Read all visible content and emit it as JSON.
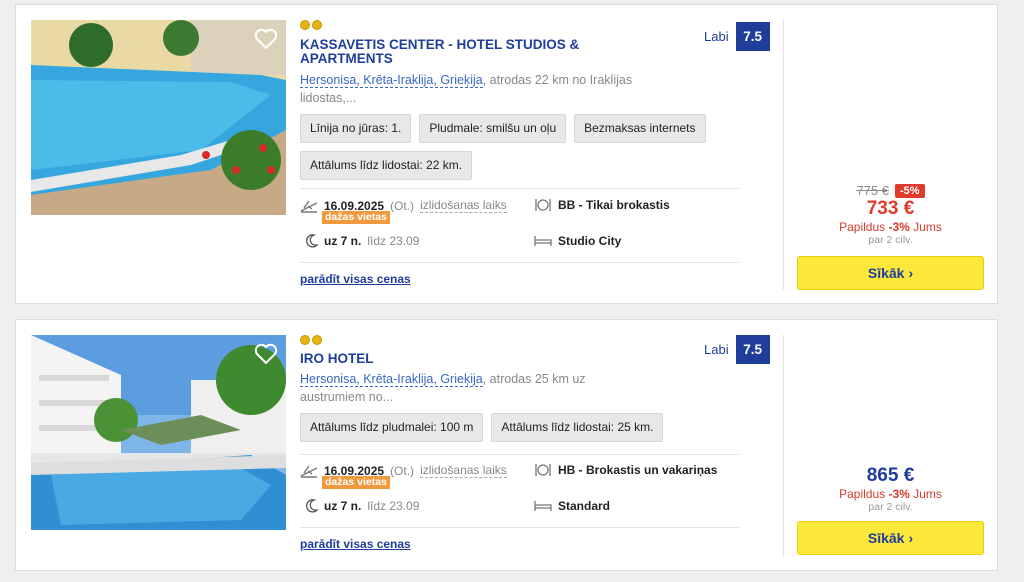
{
  "hotels": [
    {
      "stars": 2,
      "name": "KASSAVETIS CENTER - HOTEL STUDIOS & APARTMENTS",
      "location_link": "Hersonisa, Krēta-Iraklija, Grieķija",
      "location_rest": ", atrodas 22 km no Iraklijas lidostas,...",
      "rating_label": "Labi",
      "rating_score": "7.5",
      "tags": [
        "Līnija no jūras: 1.",
        "Pludmale: smilšu un oļu",
        "Bezmaksas internets",
        "Attālums līdz lidostai: 22 km."
      ],
      "date": "16.09.2025",
      "date_day": "(Ot.)",
      "departure_label": "izlidošanas laiks",
      "badge": "dažas vietas",
      "meal": "BB - Tikai brokastis",
      "duration": "uz 7 n.",
      "until": "līdz 23.09",
      "room": "Studio City",
      "show_prices": "parādīt visas cenas",
      "old_price": "775 €",
      "discount": "-5%",
      "price": "733 €",
      "extra_prefix": "Papildus ",
      "extra_bold": "-3%",
      "extra_suffix": " Jums",
      "per_persons": "par 2 cilv.",
      "button": "Sīkāk",
      "button_icon": "›"
    },
    {
      "stars": 2,
      "name": "IRO HOTEL",
      "location_link": "Hersonisa, Krēta-Iraklija, Grieķija",
      "location_rest": ", atrodas 25 km uz austrumiem no...",
      "rating_label": "Labi",
      "rating_score": "7.5",
      "tags": [
        "Attālums līdz pludmalei: 100 m",
        "Attālums līdz lidostai: 25 km."
      ],
      "date": "16.09.2025",
      "date_day": "(Ot.)",
      "departure_label": "izlidošanas laiks",
      "badge": "dažas vietas",
      "meal": "HB - Brokastis un vakariņas",
      "duration": "uz 7 n.",
      "until": "līdz 23.09",
      "room": "Standard",
      "show_prices": "parādīt visas cenas",
      "price": "865 €",
      "extra_prefix": "Papildus ",
      "extra_bold": "-3%",
      "extra_suffix": " Jums",
      "per_persons": "par 2 cilv.",
      "button": "Sīkāk",
      "button_icon": "›"
    }
  ],
  "colors": {
    "brand": "#1f3e9b",
    "price_red": "#e03a2d",
    "button": "#fce839",
    "badge": "#f19a3d"
  }
}
